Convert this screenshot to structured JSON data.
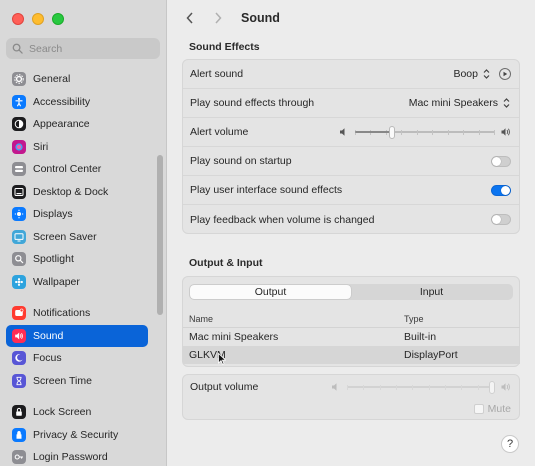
{
  "sidebar": {
    "search_placeholder": "Search",
    "items": [
      {
        "label": "General",
        "icon": "gear-icon",
        "color": "#8e8e93"
      },
      {
        "label": "Accessibility",
        "icon": "accessibility-icon",
        "color": "#0a7aff"
      },
      {
        "label": "Appearance",
        "icon": "appearance-icon",
        "color": "#1c1c1e"
      },
      {
        "label": "Siri",
        "icon": "siri-icon",
        "color": "#c2188e"
      },
      {
        "label": "Control Center",
        "icon": "control-center-icon",
        "color": "#8e8e93"
      },
      {
        "label": "Desktop & Dock",
        "icon": "dock-icon",
        "color": "#1c1c1e"
      },
      {
        "label": "Displays",
        "icon": "displays-icon",
        "color": "#0a7aff"
      },
      {
        "label": "Screen Saver",
        "icon": "screen-saver-icon",
        "color": "#41a7d8"
      },
      {
        "label": "Spotlight",
        "icon": "spotlight-icon",
        "color": "#8e8e93"
      },
      {
        "label": "Wallpaper",
        "icon": "wallpaper-icon",
        "color": "#2da3de"
      },
      {
        "label": "Notifications",
        "icon": "notifications-icon",
        "color": "#ff3b30"
      },
      {
        "label": "Sound",
        "icon": "sound-icon",
        "color": "#ff2d55"
      },
      {
        "label": "Focus",
        "icon": "focus-icon",
        "color": "#5856d6"
      },
      {
        "label": "Screen Time",
        "icon": "screen-time-icon",
        "color": "#5856d6"
      },
      {
        "label": "Lock Screen",
        "icon": "lock-screen-icon",
        "color": "#1c1c1e"
      },
      {
        "label": "Privacy & Security",
        "icon": "privacy-icon",
        "color": "#0a7aff"
      },
      {
        "label": "Login Password",
        "icon": "login-password-icon",
        "color": "#8e8e93"
      }
    ],
    "active": "Sound"
  },
  "toolbar": {
    "title": "Sound"
  },
  "sound_effects": {
    "heading": "Sound Effects",
    "alert_sound_label": "Alert sound",
    "alert_sound_value": "Boop",
    "play_through_label": "Play sound effects through",
    "play_through_value": "Mac mini Speakers",
    "alert_volume_label": "Alert volume",
    "alert_volume_level": 0.27,
    "startup_label": "Play sound on startup",
    "startup_on": false,
    "ui_sounds_label": "Play user interface sound effects",
    "ui_sounds_on": true,
    "feedback_label": "Play feedback when volume is changed",
    "feedback_on": false
  },
  "output_input": {
    "heading": "Output & Input",
    "tabs": [
      "Output",
      "Input"
    ],
    "selected_tab": "Output",
    "columns": [
      "Name",
      "Type"
    ],
    "devices": [
      {
        "name": "Mac mini Speakers",
        "type": "Built-in"
      },
      {
        "name": "GLKVM",
        "type": "DisplayPort"
      }
    ],
    "selected_device": "GLKVM",
    "output_volume_label": "Output volume",
    "output_volume_level": 1.0,
    "mute_label": "Mute"
  },
  "help_label": "?",
  "colors": {
    "accent": "#0a64d8",
    "toggle_on": "#0a74f0"
  }
}
